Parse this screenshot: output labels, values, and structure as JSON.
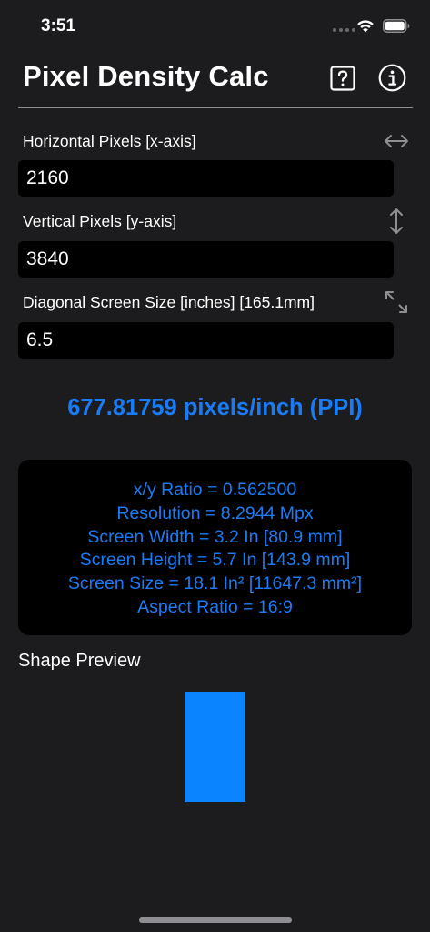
{
  "status_bar": {
    "time": "3:51",
    "icons": [
      "signal-dots-icon",
      "wifi-icon",
      "battery-icon"
    ]
  },
  "header": {
    "title": "Pixel Density Calc",
    "help_icon": "question-mark-box-icon",
    "info_icon": "info-circle-icon"
  },
  "fields": {
    "horizontal": {
      "label": "Horizontal Pixels  [x-axis]",
      "value": "2160",
      "icon": "horizontal-arrows-icon"
    },
    "vertical": {
      "label": "Vertical Pixels [y-axis]",
      "value": "3840",
      "icon": "vertical-arrows-icon"
    },
    "diagonal": {
      "label": "Diagonal Screen Size [inches] [165.1mm]",
      "value": "6.5",
      "icon": "diagonal-arrows-icon"
    }
  },
  "result": {
    "ppi": "677.81759 pixels/inch (PPI)"
  },
  "stats": [
    "x/y Ratio = 0.562500",
    "Resolution = 8.2944 Mpx",
    "Screen Width = 3.2 In [80.9 mm]",
    "Screen Height = 5.7 In [143.9 mm]",
    "Screen Size = 18.1 In² [11647.3 mm²]",
    "Aspect Ratio = 16:9"
  ],
  "preview": {
    "label": "Shape Preview"
  },
  "colors": {
    "background": "#1c1c1e",
    "field_background": "#000000",
    "accent": "#1a7cf5",
    "preview_shape": "#0a84ff",
    "divider": "#8e8e93",
    "icon_gray": "#8e8e93"
  }
}
